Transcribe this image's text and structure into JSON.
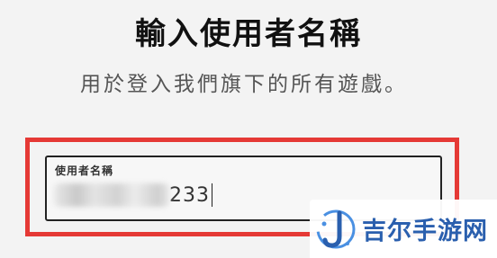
{
  "header": {
    "title": "輸入使用者名稱",
    "subtitle": "用於登入我們旗下的所有遊戲。"
  },
  "username_field": {
    "label": "使用者名稱",
    "visible_value": "233",
    "redacted_prefix": true,
    "focused": true
  },
  "highlight": {
    "color": "#e53935"
  },
  "watermark": {
    "text": "吉尔手游网",
    "logo_icon": "j-logo-icon",
    "color": "#2a5fae"
  }
}
